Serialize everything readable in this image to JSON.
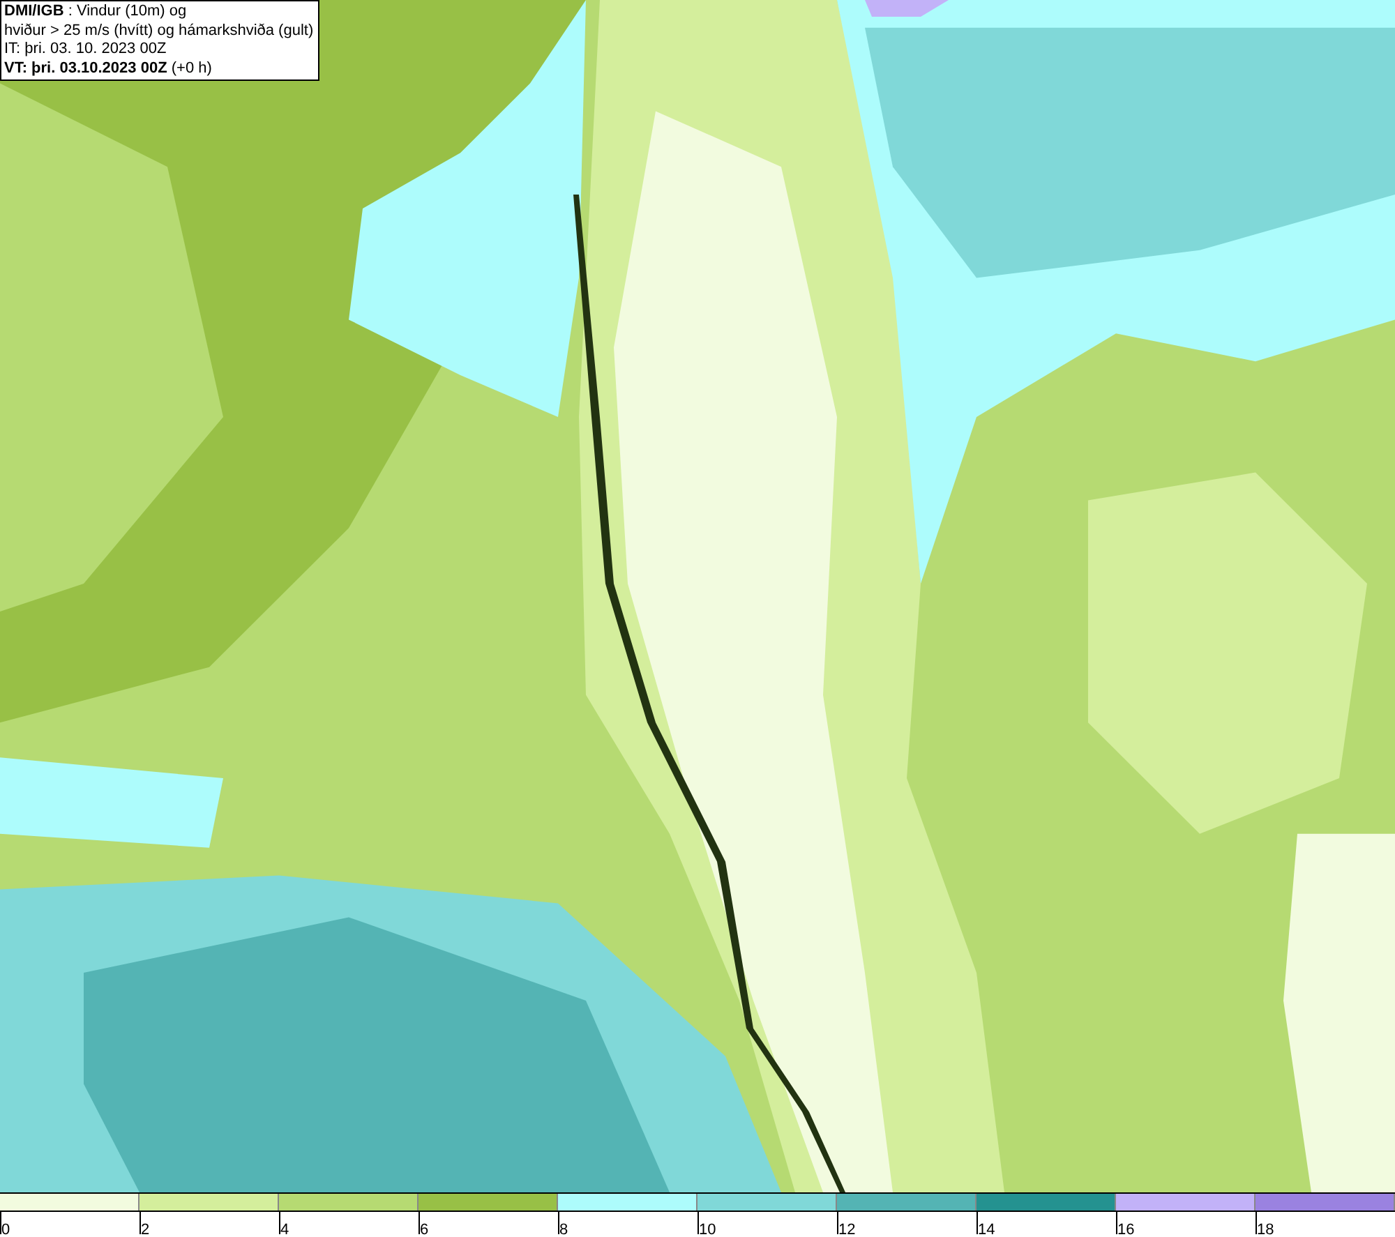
{
  "header": {
    "lines": [
      "**DMI/IGB** : Vindur (10m) og",
      "hviður > 25 m/s (hvítt) og hámarkshviða (gult)",
      "IT: þri. 03. 10. 2023 00Z",
      "**VT: þri. 03.10.2023 00Z** (+0 h)"
    ]
  },
  "legend": {
    "segments": [
      {
        "color": "#f2fbdf"
      },
      {
        "color": "#d4ee9c"
      },
      {
        "color": "#b6da72"
      },
      {
        "color": "#98c046"
      },
      {
        "color": "#adfcfc"
      },
      {
        "color": "#80d8d8"
      },
      {
        "color": "#54b4b4"
      },
      {
        "color": "#249290"
      },
      {
        "color": "#c2b2f8"
      },
      {
        "color": "#9a82e0"
      }
    ],
    "labels": [
      "0",
      "2",
      "4",
      "6",
      "8",
      "10",
      "12",
      "14",
      "16",
      "18"
    ]
  }
}
